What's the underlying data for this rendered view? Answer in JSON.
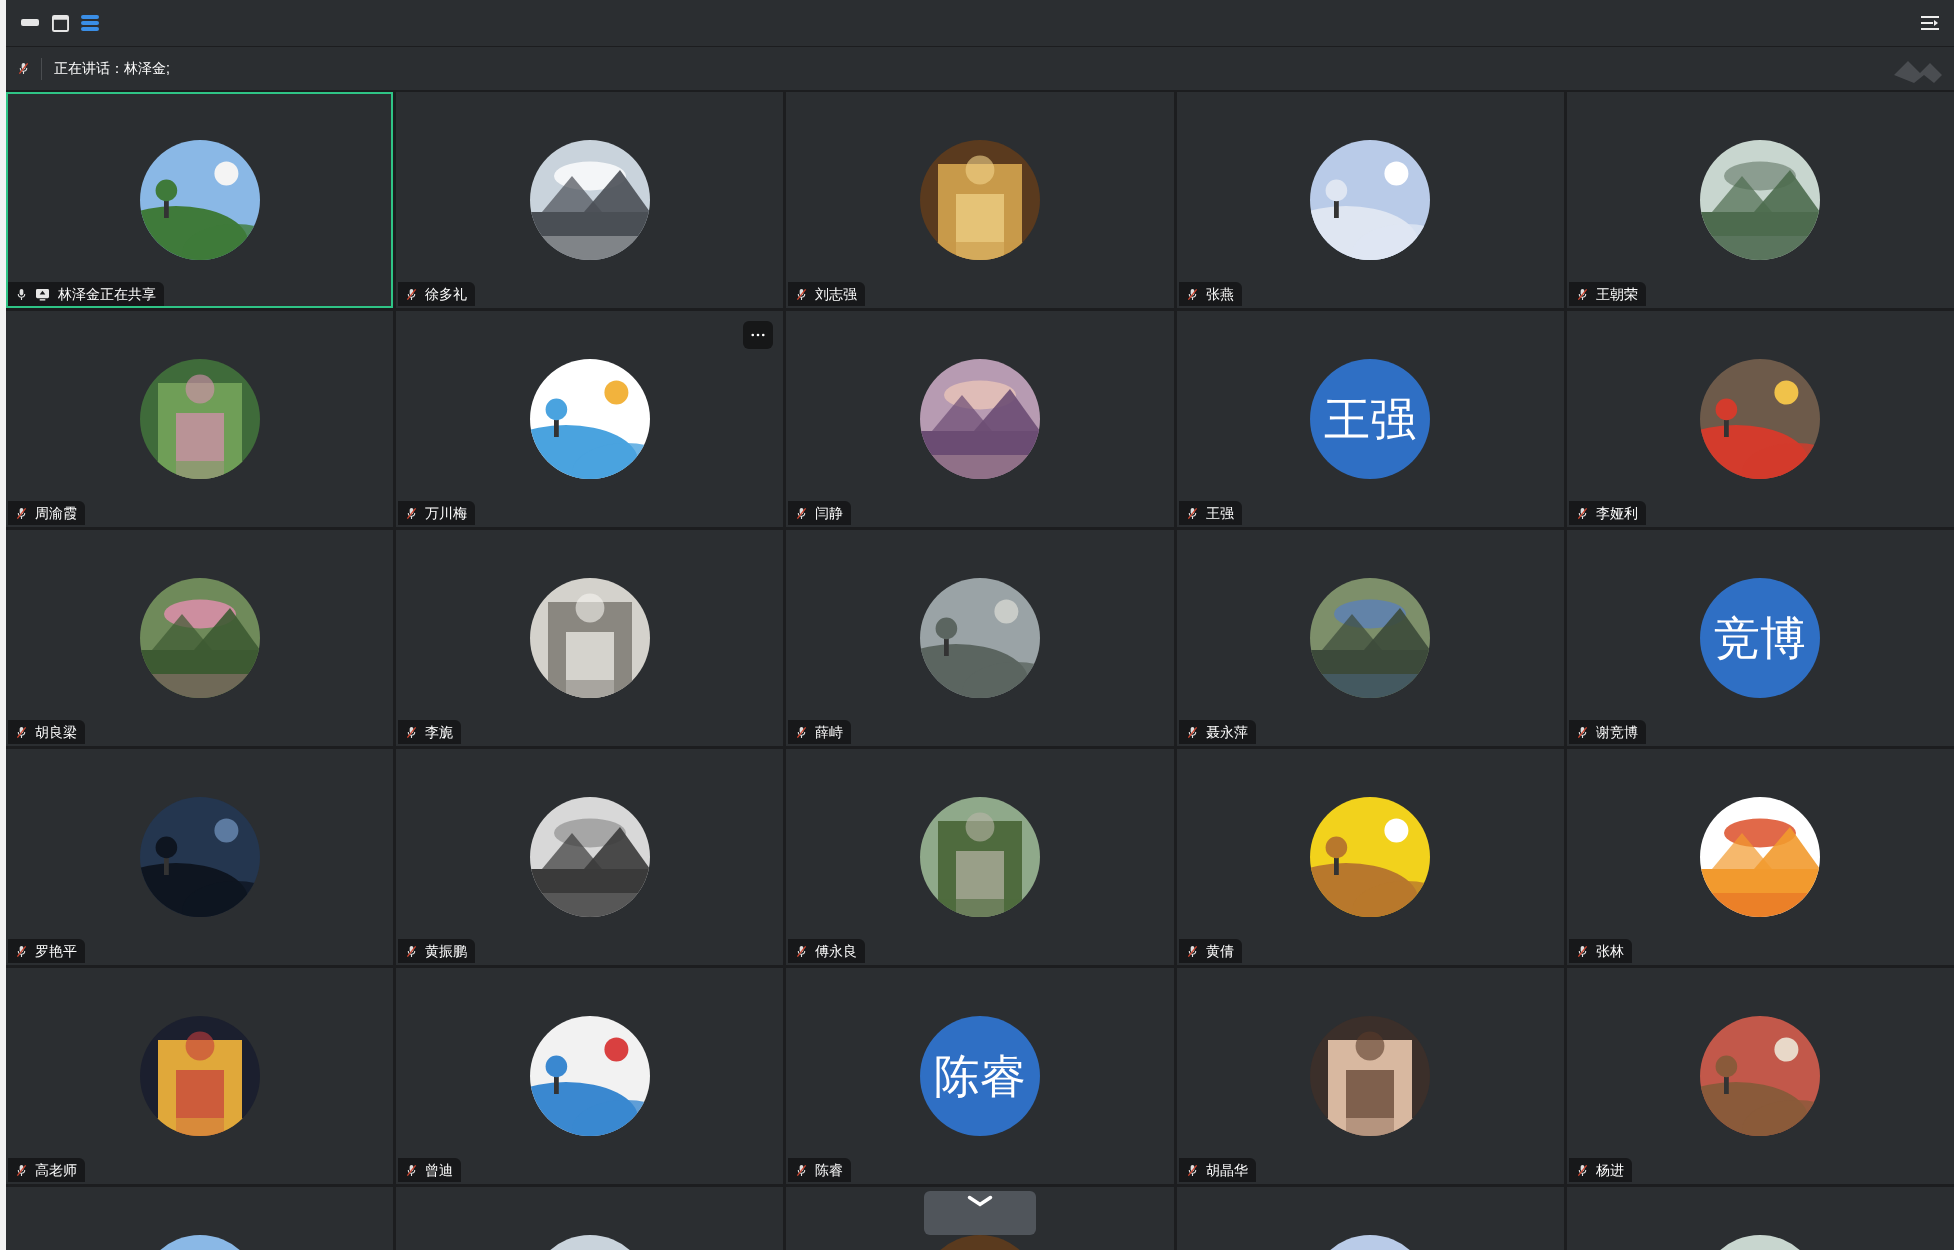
{
  "toolbar": {
    "view_buttons": [
      {
        "kind": "minimize",
        "selected": false
      },
      {
        "kind": "window",
        "selected": false
      },
      {
        "kind": "list",
        "selected": true
      }
    ]
  },
  "speaking_bar": {
    "mic_muted": true,
    "text": "正在讲话：林泽金;"
  },
  "tiles": [
    {
      "kind": "picture",
      "name": "林泽金正在共享",
      "muted": false,
      "sharing": true,
      "active": true,
      "menu": false
    },
    {
      "kind": "picture",
      "name": "徐多礼",
      "muted": true,
      "sharing": false,
      "active": false,
      "menu": false
    },
    {
      "kind": "picture",
      "name": "刘志强",
      "muted": true,
      "sharing": false,
      "active": false,
      "menu": false
    },
    {
      "kind": "picture",
      "name": "张燕",
      "muted": true,
      "sharing": false,
      "active": false,
      "menu": false
    },
    {
      "kind": "picture",
      "name": "王朝荣",
      "muted": true,
      "sharing": false,
      "active": false,
      "menu": false
    },
    {
      "kind": "picture",
      "name": "周渝霞",
      "muted": true,
      "sharing": false,
      "active": false,
      "menu": false
    },
    {
      "kind": "picture",
      "name": "万川梅",
      "muted": true,
      "sharing": false,
      "active": false,
      "menu": true
    },
    {
      "kind": "picture",
      "name": "闫静",
      "muted": true,
      "sharing": false,
      "active": false,
      "menu": false
    },
    {
      "kind": "initials",
      "initials": "王强",
      "name": "王强",
      "muted": true,
      "sharing": false,
      "active": false,
      "menu": false
    },
    {
      "kind": "picture",
      "name": "李娅利",
      "muted": true,
      "sharing": false,
      "active": false,
      "menu": false
    },
    {
      "kind": "picture",
      "name": "胡良梁",
      "muted": true,
      "sharing": false,
      "active": false,
      "menu": false
    },
    {
      "kind": "picture",
      "name": "李旎",
      "muted": true,
      "sharing": false,
      "active": false,
      "menu": false
    },
    {
      "kind": "picture",
      "name": "薛峙",
      "muted": true,
      "sharing": false,
      "active": false,
      "menu": false
    },
    {
      "kind": "picture",
      "name": "聂永萍",
      "muted": true,
      "sharing": false,
      "active": false,
      "menu": false
    },
    {
      "kind": "initials",
      "initials": "竞博",
      "name": "谢竞博",
      "muted": true,
      "sharing": false,
      "active": false,
      "menu": false
    },
    {
      "kind": "picture",
      "name": "罗艳平",
      "muted": true,
      "sharing": false,
      "active": false,
      "menu": false
    },
    {
      "kind": "picture",
      "name": "黄振鹏",
      "muted": true,
      "sharing": false,
      "active": false,
      "menu": false
    },
    {
      "kind": "picture",
      "name": "傅永良",
      "muted": true,
      "sharing": false,
      "active": false,
      "menu": false
    },
    {
      "kind": "picture",
      "name": "黄倩",
      "muted": true,
      "sharing": false,
      "active": false,
      "menu": false
    },
    {
      "kind": "picture",
      "name": "张林",
      "muted": true,
      "sharing": false,
      "active": false,
      "menu": false
    },
    {
      "kind": "picture",
      "name": "高老师",
      "muted": true,
      "sharing": false,
      "active": false,
      "menu": false
    },
    {
      "kind": "picture",
      "name": "曾迪",
      "muted": true,
      "sharing": false,
      "active": false,
      "menu": false
    },
    {
      "kind": "initials",
      "initials": "陈睿",
      "name": "陈睿",
      "muted": true,
      "sharing": false,
      "active": false,
      "menu": false
    },
    {
      "kind": "picture",
      "name": "胡晶华",
      "muted": true,
      "sharing": false,
      "active": false,
      "menu": false
    },
    {
      "kind": "picture",
      "name": "杨进",
      "muted": true,
      "sharing": false,
      "active": false,
      "menu": false
    },
    {
      "kind": "picture"
    },
    {
      "kind": "picture"
    },
    {
      "kind": "picture",
      "collapse": {
        "expanded": true
      }
    },
    {
      "kind": "picture"
    },
    {
      "kind": "picture"
    }
  ]
}
